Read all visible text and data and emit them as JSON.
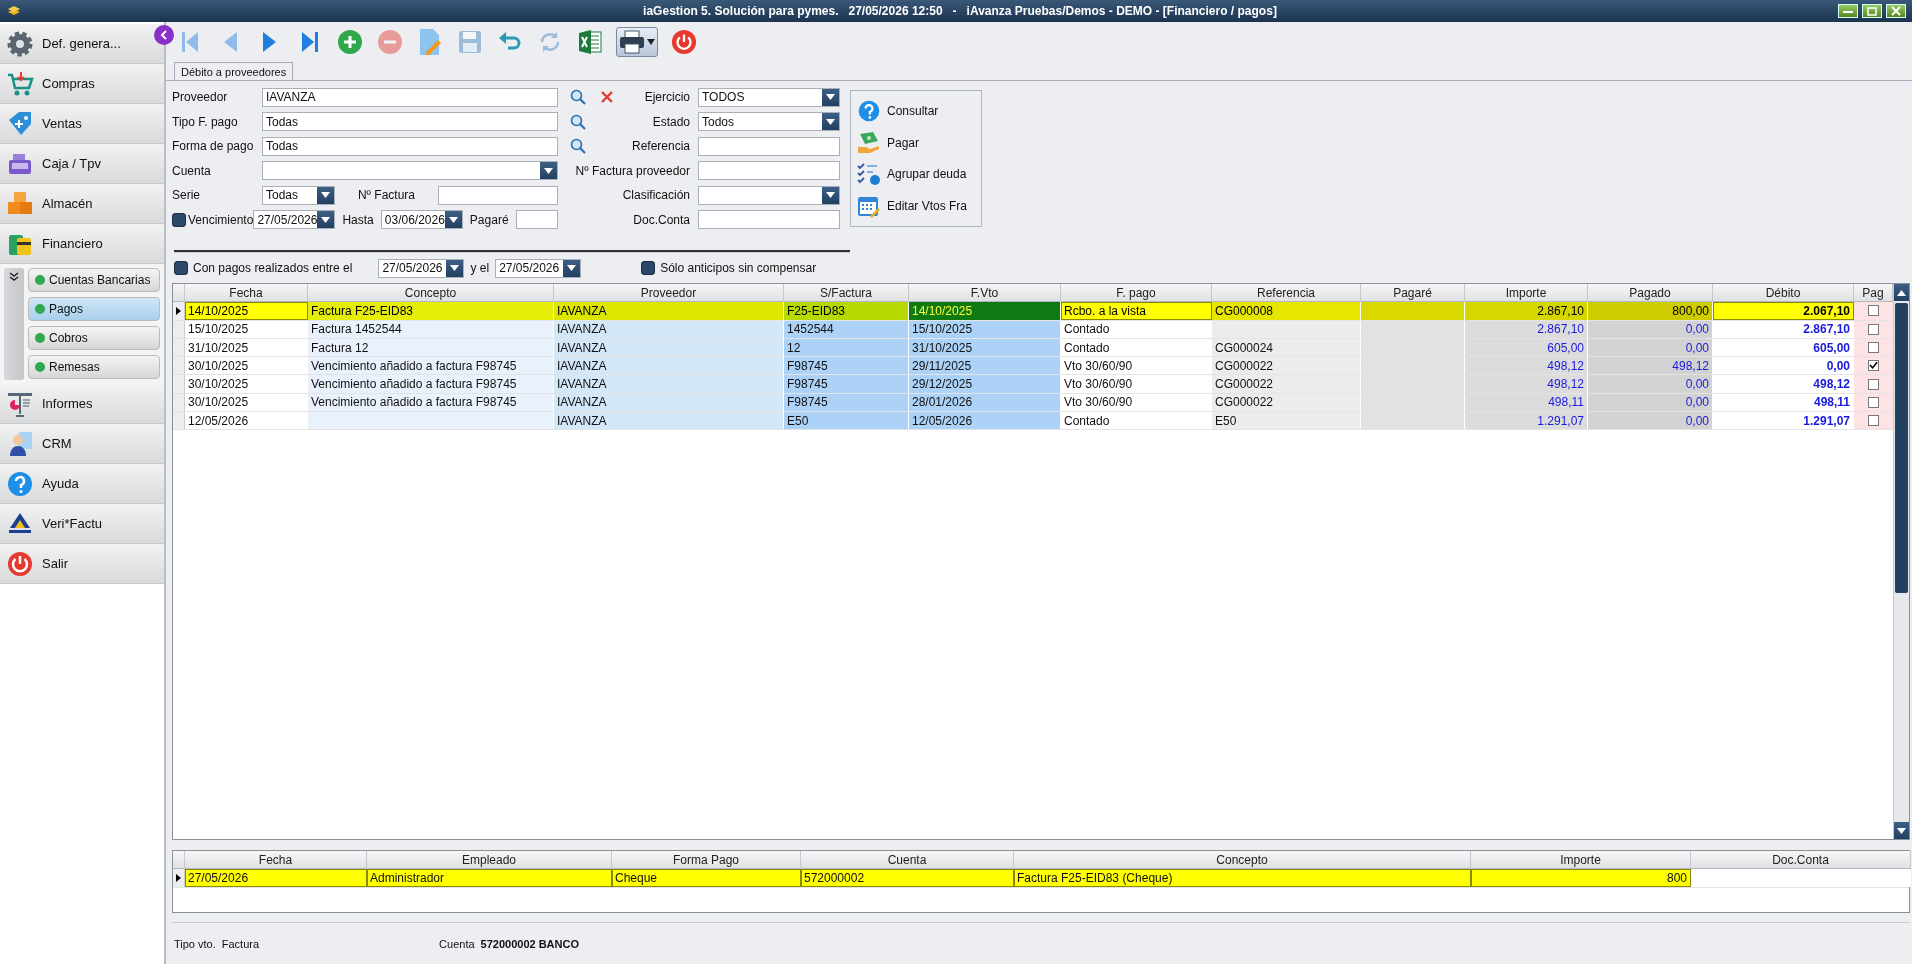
{
  "window": {
    "title": "iaGestion 5. Solución para pymes.   27/05/2026 12:50   -   iAvanza Pruebas/Demos - DEMO - [Financiero / pagos]"
  },
  "sidebar": {
    "items": [
      {
        "label": "Def. genera..."
      },
      {
        "label": "Compras"
      },
      {
        "label": "Ventas"
      },
      {
        "label": "Caja / Tpv"
      },
      {
        "label": "Almacén"
      },
      {
        "label": "Financiero",
        "children": [
          {
            "label": "Cuentas Bancarias",
            "selected": false
          },
          {
            "label": "Pagos",
            "selected": true
          },
          {
            "label": "Cobros",
            "selected": false
          },
          {
            "label": "Remesas",
            "selected": false
          }
        ]
      },
      {
        "label": "Informes"
      },
      {
        "label": "CRM"
      },
      {
        "label": "Ayuda"
      },
      {
        "label": "Veri*Factu"
      },
      {
        "label": "Salir"
      }
    ]
  },
  "toolbar": {
    "buttons": [
      {
        "disabled": true
      },
      {
        "disabled": true
      },
      {
        "disabled": false
      },
      {
        "disabled": false
      },
      {
        "disabled": false
      },
      {
        "disabled": true
      },
      {
        "disabled": false
      },
      {
        "disabled": true
      },
      {
        "disabled": false
      },
      {
        "disabled": true
      },
      {
        "disabled": false
      },
      {
        "disabled": false
      },
      {
        "disabled": false
      }
    ]
  },
  "tabs": [
    {
      "label": "Débito a proveedores",
      "selected": true
    }
  ],
  "form": {
    "proveedor": {
      "label": "Proveedor",
      "value": "IAVANZA"
    },
    "tipo_pago": {
      "label": "Tipo F. pago",
      "value": "Todas"
    },
    "forma_pago": {
      "label": "Forma de pago",
      "value": "Todas"
    },
    "cuenta": {
      "label": "Cuenta"
    },
    "serie": {
      "label": "Serie",
      "value": "Todas"
    },
    "num_factura": {
      "label": "Nº Factura"
    },
    "vencimiento": {
      "label": "Vencimiento",
      "checked": false,
      "value": "27/05/2026"
    },
    "hasta": {
      "label": "Hasta",
      "value": "03/06/2026"
    },
    "pagare": {
      "label": "Pagaré"
    },
    "ejercicio": {
      "label": "Ejercicio",
      "value": "TODOS"
    },
    "estado": {
      "label": "Estado",
      "value": "Todos"
    },
    "referencia": {
      "label": "Referencia"
    },
    "factura_proveedor": {
      "label": "Nº Factura proveedor"
    },
    "clasificacion": {
      "label": "Clasificación"
    },
    "doc_conta": {
      "label": "Doc.Conta"
    }
  },
  "actions": [
    {
      "label": "Consultar"
    },
    {
      "label": "Pagar"
    },
    {
      "label": "Agrupar deuda"
    },
    {
      "label": "Editar Vtos Fra"
    }
  ],
  "payments_filter": {
    "label": "Con pagos realizados entre el",
    "checked": false,
    "from": "27/05/2026",
    "and_label": "y el",
    "to": "27/05/2026"
  },
  "anticipos": {
    "label": "Sólo anticipos sin compensar",
    "checked": false
  },
  "table": {
    "columns": [
      "Fecha",
      "Concepto",
      "Proveedor",
      "S/Factura",
      "F.Vto",
      "F. pago",
      "Referencia",
      "Pagaré",
      "Importe",
      "Pagado",
      "Débito",
      "Pag"
    ],
    "rows": [
      {
        "selected": true,
        "fecha": "14/10/2025",
        "concepto": "Factura F25-EID83",
        "proveedor": "IAVANZA",
        "s_factura": "F25-EID83",
        "f_vto": "14/10/2025",
        "f_pago": "Rcbo. a la vista",
        "referencia": "CG000008",
        "importe": "2.867,10",
        "pagado": "800,00",
        "debito": "2.067,10",
        "pag": false
      },
      {
        "selected": false,
        "fecha": "15/10/2025",
        "concepto": "Factura 1452544",
        "proveedor": "IAVANZA",
        "s_factura": "1452544",
        "f_vto": "15/10/2025",
        "f_pago": "Contado",
        "importe": "2.867,10",
        "pagado": "0,00",
        "debito": "2.867,10",
        "pag": false
      },
      {
        "selected": false,
        "fecha": "31/10/2025",
        "concepto": "Factura 12",
        "proveedor": "IAVANZA",
        "s_factura": "12",
        "f_vto": "31/10/2025",
        "f_pago": "Contado",
        "referencia": "CG000024",
        "importe": "605,00",
        "pagado": "0,00",
        "debito": "605,00",
        "pag": false
      },
      {
        "selected": false,
        "fecha": "30/10/2025",
        "concepto": "Vencimiento añadido a factura F98745",
        "proveedor": "IAVANZA",
        "s_factura": "F98745",
        "f_vto": "29/11/2025",
        "f_pago": "Vto 30/60/90",
        "referencia": "CG000022",
        "importe": "498,12",
        "pagado": "498,12",
        "debito": "0,00",
        "pag": true
      },
      {
        "selected": false,
        "fecha": "30/10/2025",
        "concepto": "Vencimiento añadido a factura F98745",
        "proveedor": "IAVANZA",
        "s_factura": "F98745",
        "f_vto": "29/12/2025",
        "f_pago": "Vto 30/60/90",
        "referencia": "CG000022",
        "importe": "498,12",
        "pagado": "0,00",
        "debito": "498,12",
        "pag": false
      },
      {
        "selected": false,
        "fecha": "30/10/2025",
        "concepto": "Vencimiento añadido a factura F98745",
        "proveedor": "IAVANZA",
        "s_factura": "F98745",
        "f_vto": "28/01/2026",
        "f_pago": "Vto 30/60/90",
        "referencia": "CG000022",
        "importe": "498,11",
        "pagado": "0,00",
        "debito": "498,11",
        "pag": false
      },
      {
        "selected": false,
        "fecha": "12/05/2026",
        "proveedor": "IAVANZA",
        "s_factura": "E50",
        "f_vto": "12/05/2026",
        "f_pago": "Contado",
        "referencia": "E50",
        "importe": "1.291,07",
        "pagado": "0,00",
        "debito": "1.291,07",
        "pag": false
      }
    ]
  },
  "payments_table": {
    "columns": [
      "Fecha",
      "Empleado",
      "Forma Pago",
      "Cuenta",
      "Concepto",
      "Importe",
      "Doc.Conta"
    ],
    "rows": [
      {
        "selected": true,
        "fecha": "27/05/2026",
        "empleado": "Administrador",
        "forma_pago": "Cheque",
        "cuenta": "572000002",
        "concepto": "Factura F25-EID83 (Cheque)",
        "importe": "800"
      }
    ]
  },
  "status_bar": {
    "tipo_label": "Tipo vto.",
    "tipo_value": "Factura",
    "cuenta_label": "Cuenta",
    "cuenta_value": "572000002 BANCO"
  }
}
